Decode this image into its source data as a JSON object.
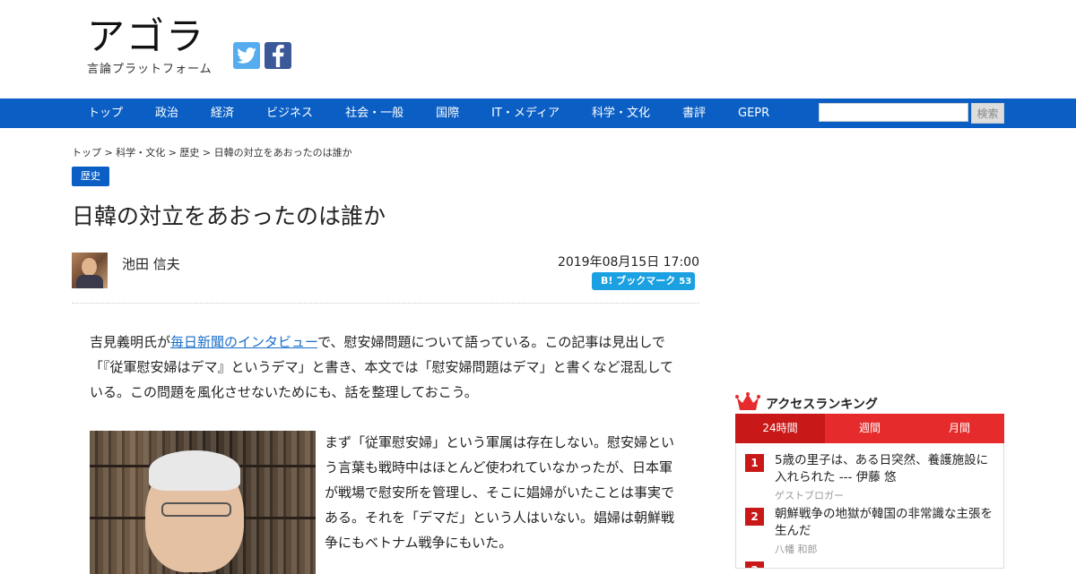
{
  "site": {
    "logo_main": "アゴラ",
    "logo_sub": "言論プラットフォーム"
  },
  "social": {
    "twitter_icon": "twitter-icon",
    "facebook_icon": "facebook-icon"
  },
  "nav": {
    "items": [
      "トップ",
      "政治",
      "経済",
      "ビジネス",
      "社会・一般",
      "国際",
      "IT・メディア",
      "科学・文化",
      "書評",
      "GEPR"
    ],
    "search_placeholder": "",
    "search_button": "検索"
  },
  "breadcrumb": "トップ > 科学・文化 > 歴史 > 日韓の対立をあおったのは誰か",
  "article": {
    "tag": "歴史",
    "title": "日韓の対立をあおったのは誰か",
    "author": "池田 信夫",
    "date": "2019年08月15日 17:00",
    "bookmark_label": "B! ブックマーク",
    "bookmark_count": "53",
    "p1_before": "吉見義明氏が",
    "p1_link": "毎日新聞のインタビュー",
    "p1_after": "で、慰安婦問題について語っている。この記事は見出しで「『従軍慰安婦はデマ』というデマ」と書き、本文では「慰安婦問題はデマ」と書くなど混乱している。この問題を風化させないためにも、話を整理しておこう。",
    "p2": "まず「従軍慰安婦」という軍属は存在しない。慰安婦という言葉も戦時中はほとんど使われていなかったが、日本軍が戦場で慰安所を管理し、そこに娼婦がいたことは事実である。それを「デマだ」という人はいない。娼婦は朝鮮戦争にもベトナム戦争にもいた。"
  },
  "ranking": {
    "title": "アクセスランキング",
    "tabs": [
      "24時間",
      "週間",
      "月間"
    ],
    "active_tab": 0,
    "items": [
      {
        "rank": "1",
        "title": "5歳の里子は、ある日突然、養護施設に入れられた --- 伊藤 悠",
        "author": "ゲストブロガー"
      },
      {
        "rank": "2",
        "title": "朝鮮戦争の地獄が韓国の非常識な主張を生んだ",
        "author": "八幡 和郎"
      },
      {
        "rank": "3",
        "title": "",
        "author": ""
      }
    ]
  },
  "colors": {
    "nav": "#0a5ec4",
    "accent_red": "#c81818",
    "hatena": "#1ba1e2"
  }
}
